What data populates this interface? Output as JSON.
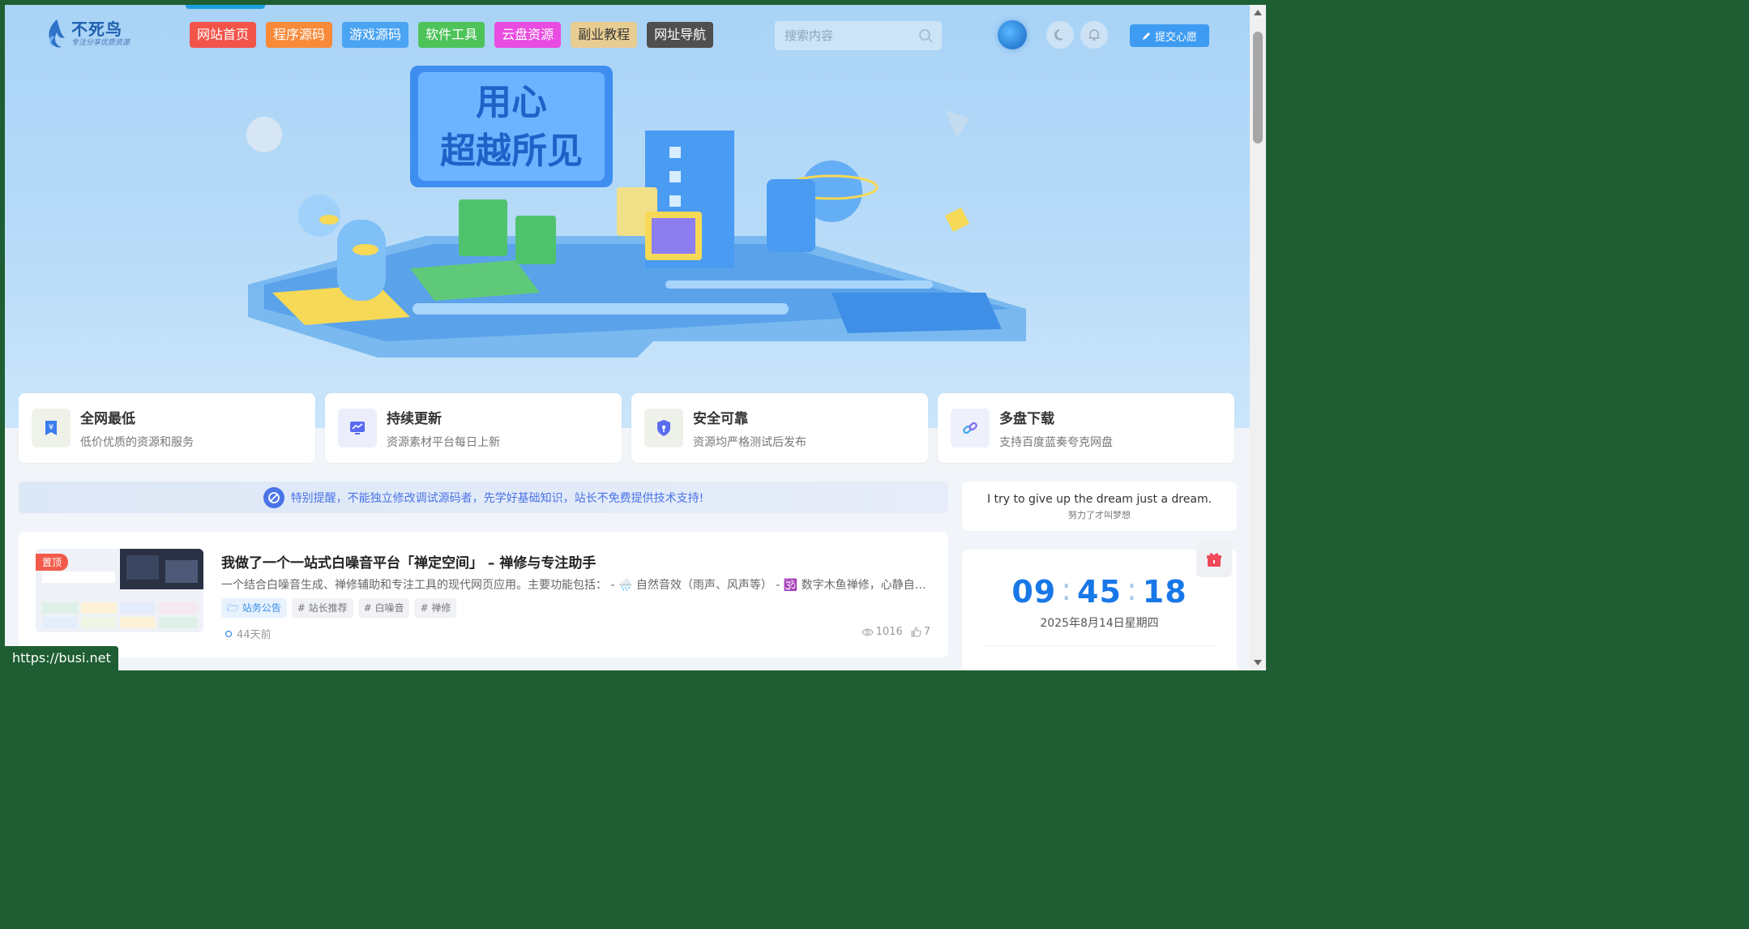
{
  "logo": {
    "title": "不死鸟",
    "subtitle": "专注分享优质资源"
  },
  "nav": [
    {
      "label": "网站首页",
      "color": "#f2544a"
    },
    {
      "label": "程序源码",
      "color": "#f88a3a"
    },
    {
      "label": "游戏源码",
      "color": "#4ba4f2"
    },
    {
      "label": "软件工具",
      "color": "#4dc35a"
    },
    {
      "label": "云盘资源",
      "color": "#e84ce0"
    },
    {
      "label": "副业教程",
      "color": "#e8cd92"
    },
    {
      "label": "网址导航",
      "color": "#4f4f4f"
    }
  ],
  "search": {
    "placeholder": "搜索内容"
  },
  "header": {
    "submit_label": "提交心愿"
  },
  "features": [
    {
      "title": "全网最低",
      "desc": "低价优质的资源和服务",
      "icon": "yen-bookmark-icon",
      "icon_bg": "#eef2e8",
      "icon_color": "#3a7df0"
    },
    {
      "title": "持续更新",
      "desc": "资源素材平台每日上新",
      "icon": "chart-monitor-icon",
      "icon_bg": "#eceefc",
      "icon_color": "#5b6cf0"
    },
    {
      "title": "安全可靠",
      "desc": "资源均严格测试后发布",
      "icon": "shield-icon",
      "icon_bg": "#eef0ea",
      "icon_color": "#5b6cf0"
    },
    {
      "title": "多盘下载",
      "desc": "支持百度蓝奏夸克网盘",
      "icon": "link-icon",
      "icon_bg": "#eef1fb",
      "icon_color": "#3aa3e8"
    }
  ],
  "notice": {
    "text": "特别提醒，不能独立修改调试源码者，先学好基础知识，站长不免费提供技术支持!"
  },
  "post": {
    "badge": "置顶",
    "title": "我做了一个一站式白噪音平台「禅定空间」 – 禅修与专注助手",
    "excerpt": "一个结合白噪音生成、禅修辅助和专注工具的现代网页应用。主要功能包括： - 🌧️ 自然音效（雨声、风声等） - 🕉️ 数字木鱼禅修，心静自然凉",
    "tags": [
      "站务公告",
      "# 站长推荐",
      "# 白噪音",
      "# 禅修"
    ],
    "time": "44天前",
    "views": "1016",
    "likes": "7"
  },
  "quote": {
    "en": "I try to give up the dream just a dream.",
    "cn": "努力了才叫梦想"
  },
  "clock": {
    "hh": "09",
    "mm": "45",
    "ss": "18",
    "date": "2025年8月14日星期四"
  },
  "status_url": "https://busi.net"
}
